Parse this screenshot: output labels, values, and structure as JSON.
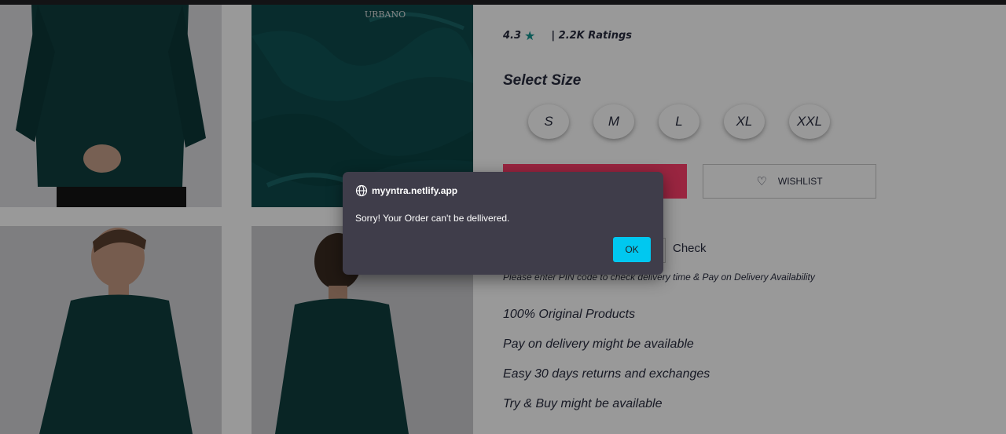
{
  "product": {
    "brand_logo": "URBANO",
    "rating_value": "4.3",
    "rating_count": "| 2.2K Ratings",
    "colors": {
      "accent": "#14958f",
      "primary": "#ff3f6c",
      "text": "#282c3f"
    }
  },
  "sizes": {
    "title": "Select Size",
    "options": [
      "S",
      "M",
      "L",
      "XL",
      "XXL"
    ]
  },
  "actions": {
    "add_to_bag_label": "",
    "wishlist_label": "WISHLIST"
  },
  "delivery": {
    "pin_placeholder": "",
    "check_label": "Check",
    "note": "Please enter PIN code to check delivery time & Pay on Delivery Availability"
  },
  "features": [
    "100% Original Products",
    "Pay on delivery might be available",
    "Easy 30 days returns and exchanges",
    "Try & Buy might be available"
  ],
  "dialog": {
    "origin": "myyntra.netlify.app",
    "message": "Sorry! Your Order can't be dellivered.",
    "ok_label": "OK",
    "button_color": "#00c8f0"
  }
}
